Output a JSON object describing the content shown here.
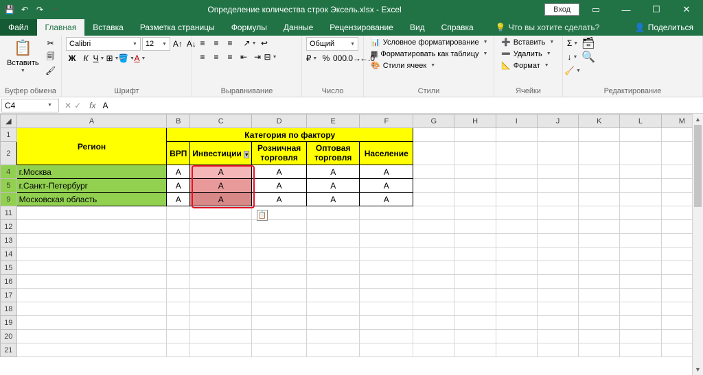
{
  "titlebar": {
    "title": "Определение количества строк Эксель.xlsx  -  Excel",
    "login": "Вход"
  },
  "tabs": {
    "file": "Файл",
    "home": "Главная",
    "insert": "Вставка",
    "layout": "Разметка страницы",
    "formulas": "Формулы",
    "data": "Данные",
    "review": "Рецензирование",
    "view": "Вид",
    "help": "Справка",
    "tellme": "Что вы хотите сделать?",
    "share": "Поделиться"
  },
  "ribbon": {
    "clipboard": {
      "label": "Буфер обмена",
      "paste": "Вставить"
    },
    "font": {
      "label": "Шрифт",
      "name": "Calibri",
      "size": "12"
    },
    "align": {
      "label": "Выравнивание"
    },
    "number": {
      "label": "Число",
      "format": "Общий"
    },
    "styles": {
      "label": "Стили",
      "cond": "Условное форматирование",
      "table": "Форматировать как таблицу",
      "cell": "Стили ячеек"
    },
    "cells": {
      "label": "Ячейки",
      "insert": "Вставить",
      "delete": "Удалить",
      "format": "Формат"
    },
    "editing": {
      "label": "Редактирование"
    }
  },
  "formula": {
    "cellref": "C4",
    "content": "A"
  },
  "sheet": {
    "cols": [
      "A",
      "B",
      "C",
      "D",
      "E",
      "F",
      "G",
      "H",
      "I",
      "J",
      "K",
      "L",
      "M"
    ],
    "rows": [
      "1",
      "2",
      "4",
      "5",
      "9",
      "11",
      "12",
      "13",
      "14",
      "15",
      "16",
      "17",
      "18",
      "19",
      "20",
      "21"
    ],
    "merged_header": "Категория по фактору",
    "h_region": "Регион",
    "h_vrp": "ВРП",
    "h_inv": "Инвестиции",
    "h_retail": "Розничная торговля",
    "h_whole": "Оптовая торговля",
    "h_pop": "Население",
    "r4a": "г.Москва",
    "r5a": "г.Санкт-Петербург",
    "r9a": "Московская область",
    "valA": "A"
  }
}
